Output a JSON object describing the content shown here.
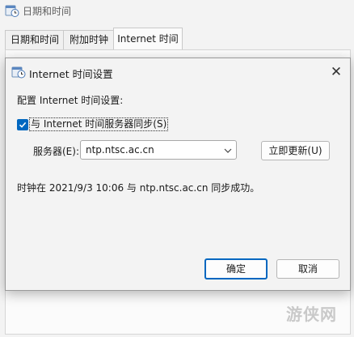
{
  "window": {
    "title": "日期和时间",
    "tabs": [
      {
        "label": "日期和时间",
        "active": false
      },
      {
        "label": "附加时钟",
        "active": false
      },
      {
        "label": "Internet 时间",
        "active": true
      }
    ]
  },
  "dialog": {
    "title": "Internet 时间设置",
    "config_label": "配置 Internet 时间设置:",
    "sync_checkbox": {
      "label": "与 Internet 时间服务器同步(S)",
      "checked": true
    },
    "server_label": "服务器(E):",
    "server_value": "ntp.ntsc.ac.cn",
    "update_button": "立即更新(U)",
    "status": "时钟在 2021/9/3 10:06 与 ntp.ntsc.ac.cn 同步成功。",
    "ok_button": "确定",
    "cancel_button": "取消",
    "close_icon": "close-icon"
  },
  "watermark": "游侠网",
  "colors": {
    "accent": "#0067c0",
    "background": "#f3f3f3"
  }
}
